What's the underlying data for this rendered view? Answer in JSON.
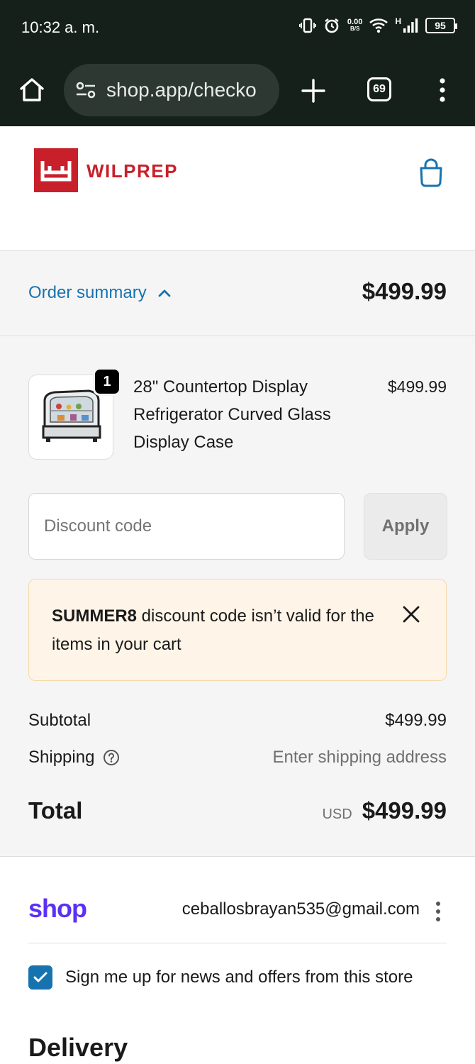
{
  "status_bar": {
    "time": "10:32 a. m.",
    "net_speed_value": "0.00",
    "net_speed_unit": "B/S",
    "network_type": "H",
    "battery": "95"
  },
  "browser": {
    "url": "shop.app/checko",
    "tab_count": "69"
  },
  "store": {
    "name": "WILPREP",
    "brand_color": "#c8202a"
  },
  "order_summary": {
    "toggle_label": "Order summary",
    "total": "$499.99",
    "accent_color": "#1773b0"
  },
  "line_item": {
    "quantity": "1",
    "name": "28\" Countertop Display Refrigerator Curved Glass Display Case",
    "price": "$499.99"
  },
  "discount": {
    "placeholder": "Discount code",
    "apply_label": "Apply"
  },
  "notice": {
    "code": "SUMMER8",
    "message": " discount code isn’t valid for the items in your cart"
  },
  "totals": {
    "subtotal_label": "Subtotal",
    "subtotal_value": "$499.99",
    "shipping_label": "Shipping",
    "shipping_value": "Enter shipping address",
    "total_label": "Total",
    "currency": "USD",
    "total_value": "$499.99"
  },
  "shop_account": {
    "logo": "shop",
    "email": "ceballosbrayan535@gmail.com",
    "logo_color": "#5a31f4"
  },
  "newsletter": {
    "checked": true,
    "label": "Sign me up for news and offers from this store"
  },
  "delivery": {
    "heading": "Delivery"
  }
}
